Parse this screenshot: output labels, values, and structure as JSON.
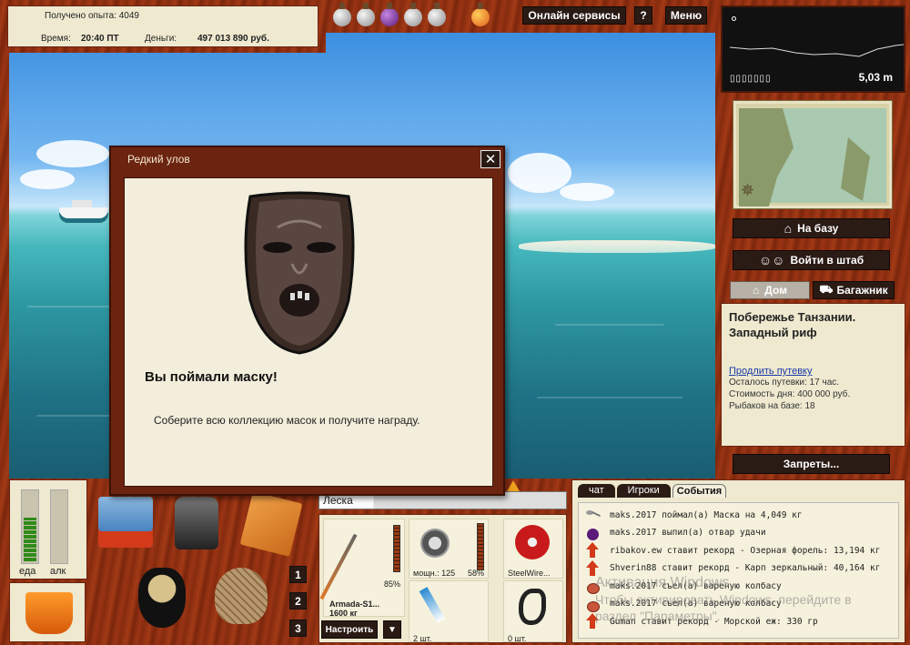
{
  "top_info": {
    "exp": "Получено опыта: 4049",
    "time_label": "Время:",
    "time_value": "20:40 ПТ",
    "money_label": "Деньги:",
    "money_value": "497 013 890 руб."
  },
  "top_buttons": {
    "online": "Онлайн сервисы",
    "help": "?",
    "menu": "Меню"
  },
  "depth": {
    "value": "5,03 m",
    "battery": "▯▯▯▯▯▯▯"
  },
  "side": {
    "to_base": "На базу",
    "hq": "Войти в штаб",
    "home_tab": "Дом",
    "trunk_tab": "Багажник",
    "bans": "Запреты..."
  },
  "location": {
    "title": "Побережье Танзании. Западный риф",
    "extend_link": "Продлить путевку",
    "days_left": "Осталось путевки: 17 час.",
    "day_cost": "Стоимость дня: 400 000 руб.",
    "fishers": "Рыбаков на базе: 18"
  },
  "dialog": {
    "title": "Редкий улов",
    "close": "✕",
    "heading": "Вы поймали маску!",
    "text": "Соберите всю коллекцию масок и получите награду."
  },
  "hud": {
    "food_label": "еда",
    "alc_label": "алк",
    "food_level": 0.62,
    "alc_level": 0.0
  },
  "slots": {
    "n1": "1",
    "n2": "2",
    "n3": "3"
  },
  "tackle": {
    "line_label": "Леска",
    "rod_name": "Armada-S1...",
    "rod_weight": "1600 кг",
    "rod_pct": "85%",
    "reel_power": "мощн.: 125",
    "reel_pct": "58%",
    "line_name": "SteelWire...",
    "hooks": "2 шт.",
    "bait": "0 шт.",
    "setup": "Настроить",
    "dropdown": "▼"
  },
  "chat": {
    "tabs": [
      "чат",
      "Игроки",
      "События"
    ],
    "entries": [
      {
        "icon": "spoon",
        "text": "maks.2017 поймал(а) Маска на 4,049 кг"
      },
      {
        "icon": "potion",
        "text": "maks.2017 выпил(а) отвар удачи"
      },
      {
        "icon": "arrow",
        "text": "ribakov.ew ставит рекорд - Озерная форель: 13,194 кг"
      },
      {
        "icon": "arrow",
        "text": "Shverin88 ставит рекорд - Карп зеркальный: 40,164 кг"
      },
      {
        "icon": "mug",
        "text": "maks.2017 съел(а) вареную колбасу"
      },
      {
        "icon": "mug",
        "text": "maks.2017 съел(а) вареную колбасу"
      },
      {
        "icon": "arrow",
        "text": "Guman ставит рекорд - Морской еж: 330 гр"
      }
    ]
  },
  "watermark": {
    "line1": "Активация Windows",
    "line2": "Чтобы активировать Windows, перейдите в",
    "line3": "раздел \"Параметры\"."
  },
  "colors": {
    "wood": "#8a2e10",
    "panel": "#eee9cf",
    "dark_button": "#2a1a14",
    "link": "#1a3aa8"
  }
}
